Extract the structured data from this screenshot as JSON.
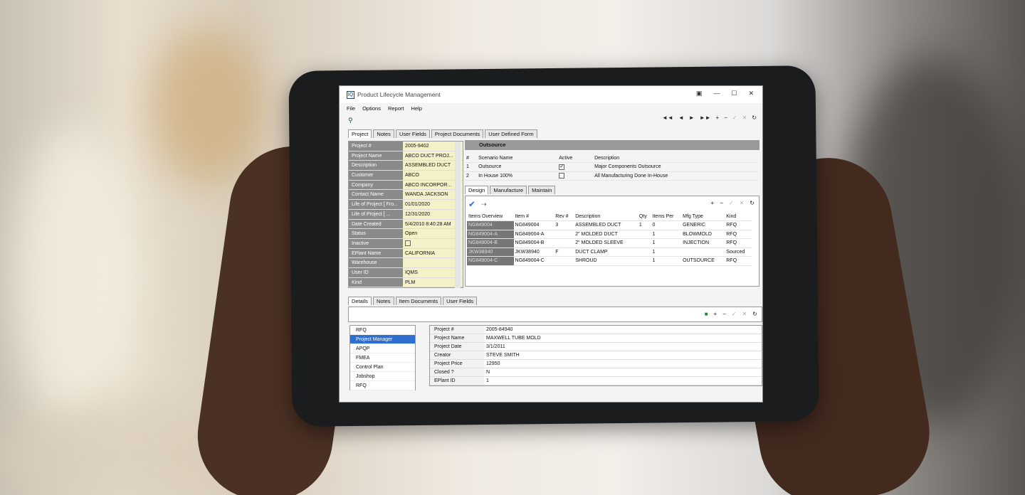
{
  "app": {
    "title": "Product Lifecycle Management",
    "logo": "IQ",
    "window_controls": [
      "minimize-icon",
      "maximize-icon",
      "close-icon"
    ]
  },
  "menu": [
    "File",
    "Options",
    "Report",
    "Help"
  ],
  "toolbar": {
    "nav": [
      "◄◄",
      "◄",
      "►",
      "►►",
      "+",
      "−",
      "✓",
      "✕",
      "↻"
    ]
  },
  "top_tabs": [
    "Project",
    "Notes",
    "User Fields",
    "Project Documents",
    "User Defined Form"
  ],
  "project_props": [
    {
      "label": "Project #",
      "value": "2005-9402"
    },
    {
      "label": "Project Name",
      "value": "ABCO DUCT PROJ..."
    },
    {
      "label": "Description",
      "value": "ASSEMBLED DUCT"
    },
    {
      "label": "Customer",
      "value": "ABCO"
    },
    {
      "label": "Company",
      "value": "ABCO INCORPOR..."
    },
    {
      "label": "Contact Name",
      "value": "WANDA JACKSON"
    },
    {
      "label": "Life of Project [ Fro...",
      "value": "01/01/2020"
    },
    {
      "label": "Life of Project [ ...",
      "value": "12/31/2020"
    },
    {
      "label": "Date Created",
      "value": "5/4/2010 8:40:28 AM"
    },
    {
      "label": "Status",
      "value": "Open"
    },
    {
      "label": "Inactive",
      "value": ""
    },
    {
      "label": "EPlant Name",
      "value": "CALIFORNIA"
    },
    {
      "label": "Warehouse",
      "value": ""
    },
    {
      "label": "User ID",
      "value": "IQMS"
    },
    {
      "label": "Kind",
      "value": "PLM"
    }
  ],
  "outsource": {
    "title": "Outsource",
    "headers": [
      "#",
      "Scenario Name",
      "Active",
      "Description"
    ],
    "rows": [
      {
        "num": "1",
        "name": "Outsource",
        "active": true,
        "desc": "Major Components Outsource"
      },
      {
        "num": "2",
        "name": "In House 100%",
        "active": false,
        "desc": "All Manufacturing Done In-House"
      }
    ]
  },
  "mid_tabs": [
    "Design",
    "Manufacture",
    "Maintain"
  ],
  "design": {
    "headers": [
      "Items Overview",
      "Item #",
      "Rev #",
      "Description",
      "Qty",
      "Items Per",
      "Mfg Type",
      "Kind"
    ],
    "rows": [
      {
        "overview": "NG849004",
        "item": "NG849004",
        "rev": "3",
        "desc": "ASSEMBLED DUCT",
        "qty": "1",
        "per": "0",
        "mfg": "GENERIC",
        "kind": "RFQ"
      },
      {
        "overview": "NG849004-A",
        "item": "NG849004-A",
        "rev": "",
        "desc": "2\" MOLDED DUCT",
        "qty": "",
        "per": "1",
        "mfg": "BLOWMOLD",
        "kind": "RFQ"
      },
      {
        "overview": "NG849004-B",
        "item": "NG849004-B",
        "rev": "",
        "desc": "2\" MOLDED SLEEVE",
        "qty": "",
        "per": "1",
        "mfg": "INJECTION",
        "kind": "RFQ"
      },
      {
        "overview": "JKW38940",
        "item": "JKW38940",
        "rev": "F",
        "desc": "DUCT CLAMP",
        "qty": "",
        "per": "1",
        "mfg": "",
        "kind": "Sourced"
      },
      {
        "overview": "NG849004-C",
        "item": "NG849004-C",
        "rev": "",
        "desc": "SHROUD",
        "qty": "",
        "per": "1",
        "mfg": "OUTSOURCE",
        "kind": "RFQ"
      }
    ]
  },
  "bottom_tabs": [
    "Details",
    "Notes",
    "Item Documents",
    "User Fields"
  ],
  "list_items": [
    "RFQ",
    "Project Manager",
    "APQP",
    "FMEA",
    "Control Plan",
    "Jobshop",
    "RFQ"
  ],
  "details": [
    {
      "label": "Project #",
      "value": "2005-84940"
    },
    {
      "label": "Project Name",
      "value": "MAXWELL TUBE MOLD"
    },
    {
      "label": "Project Date",
      "value": "3/1/2011"
    },
    {
      "label": "Creator",
      "value": "STEVE SMITH"
    },
    {
      "label": "Project Price",
      "value": "12950"
    },
    {
      "label": "Closed ?",
      "value": "N"
    },
    {
      "label": "EPlant ID",
      "value": "1"
    }
  ]
}
